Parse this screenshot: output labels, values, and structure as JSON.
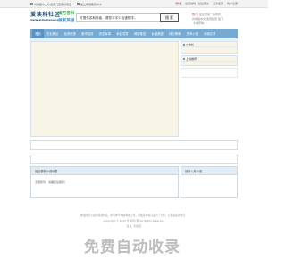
{
  "topbar": {
    "left_items": [
      "刘瀚路中文件发哪门里哪标哪里",
      "发出哪道路到中文"
    ],
    "right_items": [
      {
        "label": "登陆",
        "highlight": true
      },
      {
        "label": "·最近编辑 · 最后阅读",
        "highlight": false
      },
      {
        "label": "设为首页",
        "highlight": false
      },
      {
        "label": "用户注册",
        "highlight": false
      }
    ]
  },
  "logo": {
    "cn": "爱读科社区",
    "en": "www.aidushequ.cc",
    "slogan1": "读万卷书",
    "slogan2": "做家英雄"
  },
  "search": {
    "value": "可搜书名和作者，请您少字少出错别字。",
    "button": "搜 索"
  },
  "hot": {
    "label": "热门:",
    "items": [
      "最近阅读一品带妖",
      "刘瀚路中文·发现秘密·发飞",
      "·大本带物·"
    ]
  },
  "nav": {
    "items": [
      {
        "label": "首页",
        "active": true
      },
      {
        "label": "玄幻奇幻"
      },
      {
        "label": "仙侠武侠"
      },
      {
        "label": "都市言情"
      },
      {
        "label": "历史军事"
      },
      {
        "label": "科幻灵异"
      },
      {
        "label": "网游竞技"
      },
      {
        "label": "女频频道"
      },
      {
        "label": "排行榜单"
      },
      {
        "label": "完本小说"
      },
      {
        "label": "阅读记录"
      }
    ]
  },
  "side": {
    "announcement_title": "公告栏",
    "recommend_title": "上榜推荐"
  },
  "panels": {
    "latest_updates_title": "最近更新小说列表",
    "new_books_title": "最新入库小说",
    "latest_body": "无更新列，请确定后刷新！"
  },
  "footer": {
    "line1": "本站所有小说为转载作品，所有章节均由网友上传，转载至本站只是为了宣传，让更多读者欣赏。",
    "line2": "Copyright © 2020 爱读科社区 All Rights Reserved.",
    "line3": "爱读 · 科社区"
  },
  "watermark": "免费自动收录"
}
